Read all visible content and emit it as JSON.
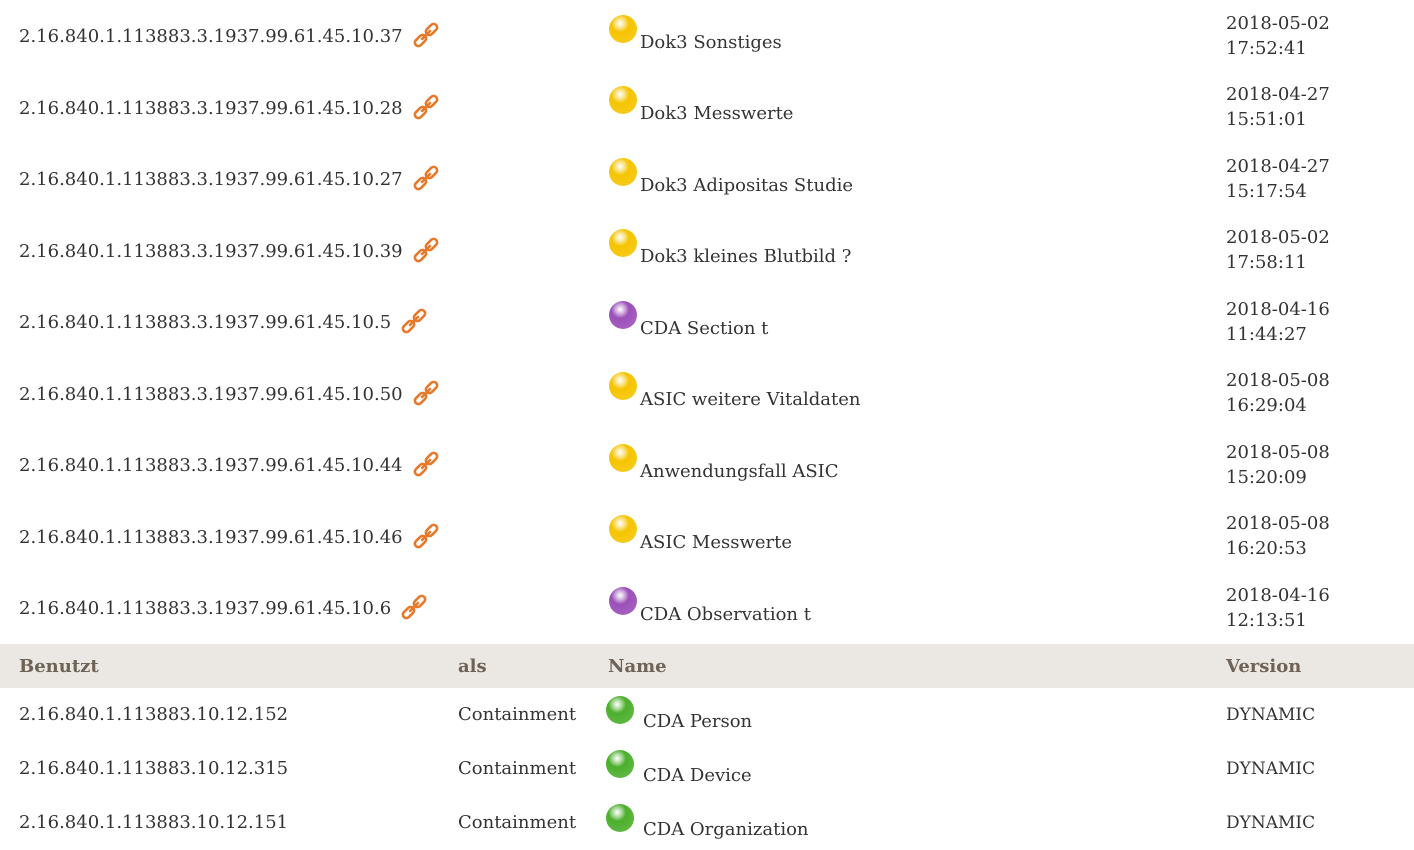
{
  "upper_rows": [
    {
      "id": "2.16.840.1.113883.3.1937.99.61.45.10.37",
      "name": "Dok3 Sonstiges",
      "status_color": "#f5c400",
      "date": "2018-05-02",
      "time": "17:52:41"
    },
    {
      "id": "2.16.840.1.113883.3.1937.99.61.45.10.28",
      "name": "Dok3 Messwerte",
      "status_color": "#f5c400",
      "date": "2018-04-27",
      "time": "15:51:01"
    },
    {
      "id": "2.16.840.1.113883.3.1937.99.61.45.10.27",
      "name": "Dok3 Adipositas Studie",
      "status_color": "#f5c400",
      "date": "2018-04-27",
      "time": "15:17:54"
    },
    {
      "id": "2.16.840.1.113883.3.1937.99.61.45.10.39",
      "name": "Dok3 kleines Blutbild ?",
      "status_color": "#f5c400",
      "date": "2018-05-02",
      "time": "17:58:11"
    },
    {
      "id": "2.16.840.1.113883.3.1937.99.61.45.10.5",
      "name": "CDA Section t",
      "status_color": "#9b4fb8",
      "date": "2018-04-16",
      "time": "11:44:27"
    },
    {
      "id": "2.16.840.1.113883.3.1937.99.61.45.10.50",
      "name": "ASIC weitere Vitaldaten",
      "status_color": "#f5c400",
      "date": "2018-05-08",
      "time": "16:29:04"
    },
    {
      "id": "2.16.840.1.113883.3.1937.99.61.45.10.44",
      "name": "Anwendungsfall ASIC",
      "status_color": "#f5c400",
      "date": "2018-05-08",
      "time": "15:20:09"
    },
    {
      "id": "2.16.840.1.113883.3.1937.99.61.45.10.46",
      "name": "ASIC Messwerte",
      "status_color": "#f5c400",
      "date": "2018-05-08",
      "time": "16:20:53"
    },
    {
      "id": "2.16.840.1.113883.3.1937.99.61.45.10.6",
      "name": "CDA Observation t",
      "status_color": "#9b4fb8",
      "date": "2018-04-16",
      "time": "12:13:51"
    }
  ],
  "used_table": {
    "headers": {
      "benutzt": "Benutzt",
      "als": "als",
      "name": "Name",
      "version": "Version"
    },
    "rows": [
      {
        "id": "2.16.840.1.113883.10.12.152",
        "als": "Containment",
        "name": "CDA Person",
        "status_color": "#4caf2c",
        "version": "DYNAMIC"
      },
      {
        "id": "2.16.840.1.113883.10.12.315",
        "als": "Containment",
        "name": "CDA Device",
        "status_color": "#4caf2c",
        "version": "DYNAMIC"
      },
      {
        "id": "2.16.840.1.113883.10.12.151",
        "als": "Containment",
        "name": "CDA Organization",
        "status_color": "#4caf2c",
        "version": "DYNAMIC"
      }
    ]
  },
  "icons": {
    "link": "link-icon",
    "status": "status-ball-icon"
  },
  "colors": {
    "header_bg": "#ebe7e2",
    "header_text": "#6e6357",
    "link_icon": "#e8792b"
  }
}
